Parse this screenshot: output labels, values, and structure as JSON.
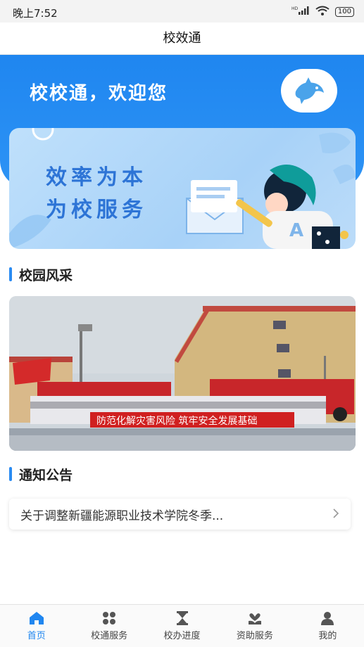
{
  "status_bar": {
    "time": "晚上7:52",
    "signal": "HD",
    "battery": "100"
  },
  "header": {
    "title": "校效通"
  },
  "hero": {
    "welcome": "校校通，欢迎您"
  },
  "banner": {
    "line1": "效率为本",
    "line2": "为校服务"
  },
  "sections": {
    "campus": "校园风采",
    "notice": "通知公告"
  },
  "photo": {
    "banner_text": "防范化解灾害风险  筑牢安全发展基础"
  },
  "notice": {
    "item": "关于调整新疆能源职业技术学院冬季..."
  },
  "tabs": [
    {
      "label": "首页",
      "icon": "home-icon",
      "active": true
    },
    {
      "label": "校通服务",
      "icon": "grid-icon",
      "active": false
    },
    {
      "label": "校办进度",
      "icon": "hourglass-icon",
      "active": false
    },
    {
      "label": "资助服务",
      "icon": "heart-hand-icon",
      "active": false
    },
    {
      "label": "我的",
      "icon": "user-icon",
      "active": false
    }
  ],
  "colors": {
    "primary": "#1f86f0",
    "banner_text": "#2d74d6",
    "tab_inactive": "#444444"
  }
}
